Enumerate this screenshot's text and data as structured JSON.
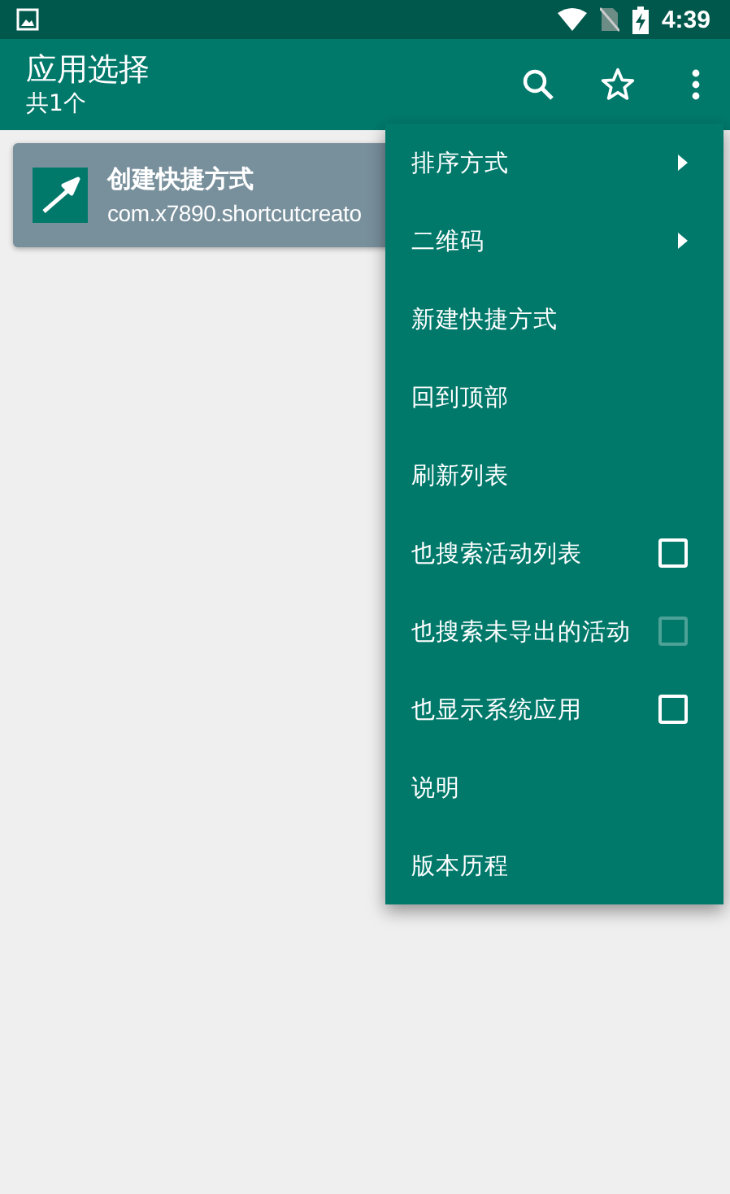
{
  "status_bar": {
    "time": "4:39"
  },
  "toolbar": {
    "title": "应用选择",
    "subtitle": "共1个"
  },
  "apps": [
    {
      "name": "创建快捷方式",
      "package": "com.x7890.shortcutcreato"
    }
  ],
  "menu": [
    {
      "kind": "submenu",
      "label": "排序方式"
    },
    {
      "kind": "submenu",
      "label": "二维码"
    },
    {
      "kind": "plain",
      "label": "新建快捷方式"
    },
    {
      "kind": "plain",
      "label": "回到顶部"
    },
    {
      "kind": "plain",
      "label": "刷新列表"
    },
    {
      "kind": "checkbox",
      "label": "也搜索活动列表",
      "checked": false,
      "disabled": false
    },
    {
      "kind": "checkbox",
      "label": "也搜索未导出的活动",
      "checked": false,
      "disabled": true
    },
    {
      "kind": "checkbox",
      "label": "也显示系统应用",
      "checked": false,
      "disabled": false
    },
    {
      "kind": "plain",
      "label": "说明"
    },
    {
      "kind": "plain",
      "label": "版本历程"
    }
  ]
}
